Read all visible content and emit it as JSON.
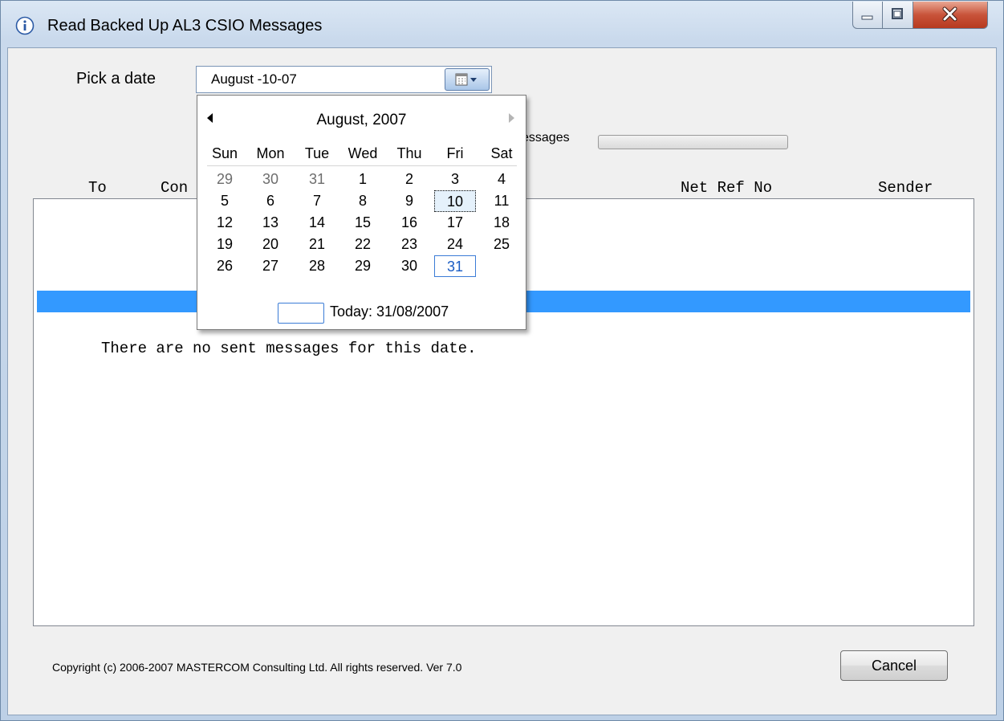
{
  "window": {
    "title": "Read Backed Up AL3 CSIO Messages",
    "controls": [
      "minimize-icon",
      "maximize-icon",
      "close-icon"
    ]
  },
  "date_picker": {
    "label": "Pick a date",
    "value": "August   -10-07"
  },
  "progress": {
    "label": "essages",
    "value": 0
  },
  "columns": {
    "to": "To",
    "cont": "Con",
    "net_ref_no": "Net Ref No",
    "sender": "Sender"
  },
  "list": {
    "empty_message": "There are no sent messages for this date."
  },
  "calendar": {
    "month_title": "August, 2007",
    "day_names": [
      "Sun",
      "Mon",
      "Tue",
      "Wed",
      "Thu",
      "Fri",
      "Sat"
    ],
    "weeks": [
      [
        "29",
        "30",
        "31",
        "1",
        "2",
        "3",
        "4"
      ],
      [
        "5",
        "6",
        "7",
        "8",
        "9",
        "10",
        "11"
      ],
      [
        "12",
        "13",
        "14",
        "15",
        "16",
        "17",
        "18"
      ],
      [
        "19",
        "20",
        "21",
        "22",
        "23",
        "24",
        "25"
      ],
      [
        "26",
        "27",
        "28",
        "29",
        "30",
        "31",
        ""
      ]
    ],
    "other_month_days": [
      "29",
      "30",
      "31"
    ],
    "focused_day": "10",
    "today_day": "31",
    "today_label": "Today: 31/08/2007"
  },
  "footer": {
    "copyright": "Copyright (c) 2006-2007 MASTERCOM Consulting Ltd. All rights reserved. Ver 7.0",
    "cancel_label": "Cancel"
  },
  "colors": {
    "selection": "#3399ff",
    "today_border": "#3b7cd6",
    "close_button": "#c8533a"
  }
}
